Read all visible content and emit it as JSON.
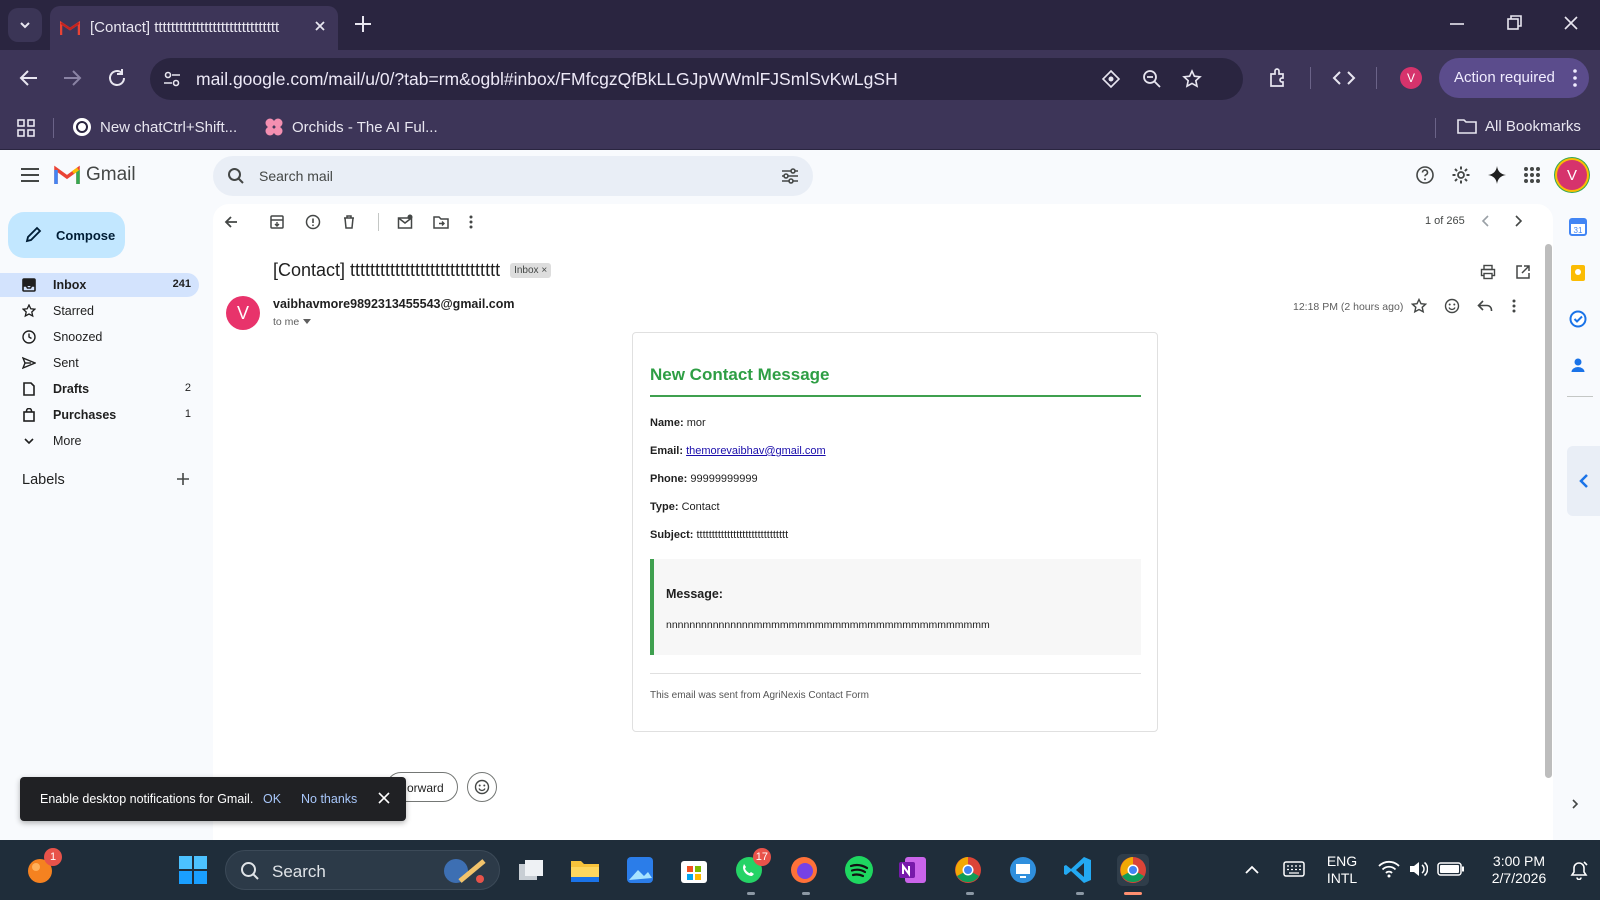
{
  "browser": {
    "tab_title": "[Contact] tttttttttttttttttttttttttttttt",
    "url": "mail.google.com/mail/u/0/?tab=rm&ogbl#inbox/FMfcgzQfBkLLGJpWWmlFJSmlSvKwLgSH",
    "profile_initial": "V",
    "action_label": "Action required",
    "bookmarks": [
      {
        "label": "New chatCtrl+Shift..."
      },
      {
        "label": "Orchids - The AI Ful..."
      }
    ],
    "all_bookmarks": "All Bookmarks"
  },
  "gmail": {
    "app_name": "Gmail",
    "search_placeholder": "Search mail",
    "compose_label": "Compose",
    "nav": [
      {
        "label": "Inbox",
        "count": "241",
        "icon": "inbox-icon"
      },
      {
        "label": "Starred",
        "count": "",
        "icon": "star-icon"
      },
      {
        "label": "Snoozed",
        "count": "",
        "icon": "clock-icon"
      },
      {
        "label": "Sent",
        "count": "",
        "icon": "send-icon"
      },
      {
        "label": "Drafts",
        "count": "2",
        "icon": "draft-icon"
      },
      {
        "label": "Purchases",
        "count": "1",
        "icon": "bag-icon"
      },
      {
        "label": "More",
        "count": "",
        "icon": "chevron-down-icon"
      }
    ],
    "labels_heading": "Labels",
    "account_initial": "V"
  },
  "message": {
    "pager": "1 of 265",
    "subject": "[Contact] tttttttttttttttttttttttttttttt",
    "label_chip": "Inbox",
    "sender_initial": "V",
    "sender": "vaibhavmore9892313455543@gmail.com",
    "to": "to me",
    "time": "12:18 PM (2 hours ago)",
    "card": {
      "heading": "New Contact Message",
      "name_label": "Name:",
      "name_value": "mor",
      "email_label": "Email:",
      "email_value": "themorevaibhav@gmail.com",
      "phone_label": "Phone:",
      "phone_value": "99999999999",
      "type_label": "Type:",
      "type_value": "Contact",
      "subject_label": "Subject:",
      "subject_value": "tttttttttttttttttttttttttttttt",
      "message_label": "Message:",
      "message_value": "nnnnnnnnnnnnnnnmmmmmmmmmmmmmmmmmmmmmmmmmmm",
      "footer": "This email was sent from AgriNexis Contact Form"
    },
    "forward_label": "orward"
  },
  "toast": {
    "text": "Enable desktop notifications for Gmail.",
    "ok": "OK",
    "no_thanks": "No thanks"
  },
  "taskbar": {
    "search_label": "Search",
    "whatsapp_badge": "17",
    "notif_badge": "1",
    "lang_top": "ENG",
    "lang_bottom": "INTL",
    "time": "3:00 PM",
    "date": "2/7/2026"
  },
  "colors": {
    "accent_green": "#2e9e44",
    "chrome_purple": "#3d3558",
    "avatar_pink": "#e8336b"
  }
}
